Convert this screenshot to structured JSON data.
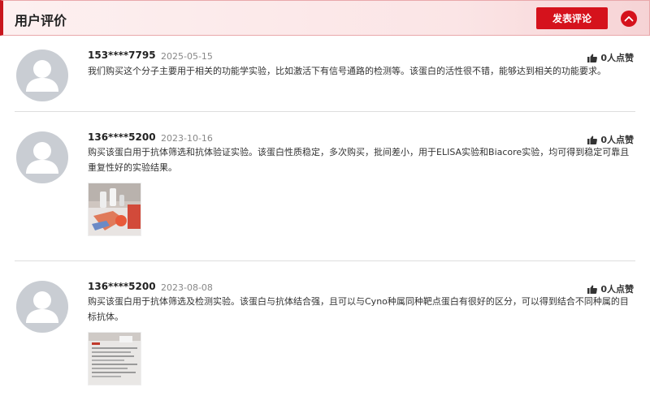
{
  "header": {
    "title": "用户评价",
    "post_button": "发表评论"
  },
  "reviews": [
    {
      "user": "153****7795",
      "date": "2025-05-15",
      "likes": "0人点赞",
      "text": "我们购买这个分子主要用于相关的功能学实验，比如激活下有信号通路的检测等。该蛋白的活性很不错，能够达到相关的功能要求。"
    },
    {
      "user": "136****5200",
      "date": "2023-10-16",
      "likes": "0人点赞",
      "text": "购买该蛋白用于抗体筛选和抗体验证实验。该蛋白性质稳定，多次购买，批间差小，用于ELISA实验和Biacore实验，均可得到稳定可靠且重复性好的实验结果。"
    },
    {
      "user": "136****5200",
      "date": "2023-08-08",
      "likes": "0人点赞",
      "text": "购买该蛋白用于抗体筛选及检测实验。该蛋白与抗体结合强，且可以与Cyno种属同种靶点蛋白有很好的区分，可以得到结合不同种属的目标抗体。"
    }
  ],
  "colors": {
    "accent": "#d5121c",
    "avatar_bg": "#c9cdd3",
    "header_bg": "#fbe5e6"
  },
  "icons": {
    "like": "thumbs-up-icon",
    "collapse": "chevron-up-icon",
    "avatar": "user-silhouette-icon"
  }
}
